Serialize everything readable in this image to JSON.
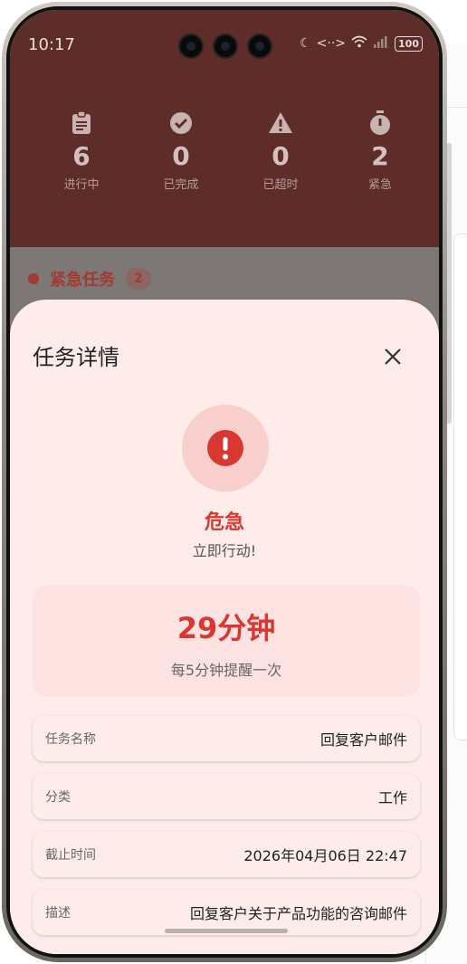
{
  "statusbar": {
    "time": "10:17",
    "battery": "100"
  },
  "stats": [
    {
      "icon": "clipboard-icon",
      "value": "6",
      "label": "进行中"
    },
    {
      "icon": "check-circle-icon",
      "value": "0",
      "label": "已完成"
    },
    {
      "icon": "warning-icon",
      "value": "0",
      "label": "已超时"
    },
    {
      "icon": "stopwatch-icon",
      "value": "2",
      "label": "紧急"
    }
  ],
  "urgent": {
    "title": "紧急任务",
    "count": "2"
  },
  "sheet": {
    "title": "任务详情",
    "level": "危急",
    "level_sub": "立即行动!",
    "countdown": "29分钟",
    "reminder": "每5分钟提醒一次",
    "fields": [
      {
        "key": "任务名称",
        "value": "回复客户邮件"
      },
      {
        "key": "分类",
        "value": "工作"
      },
      {
        "key": "截止时间",
        "value": "2026年04月06日 22:47"
      },
      {
        "key": "描述",
        "value": "回复客户关于产品功能的咨询邮件"
      }
    ]
  },
  "colors": {
    "accent": "#d93832",
    "sheet_bg": "#fdecea",
    "card_bg": "#fde2e2"
  }
}
